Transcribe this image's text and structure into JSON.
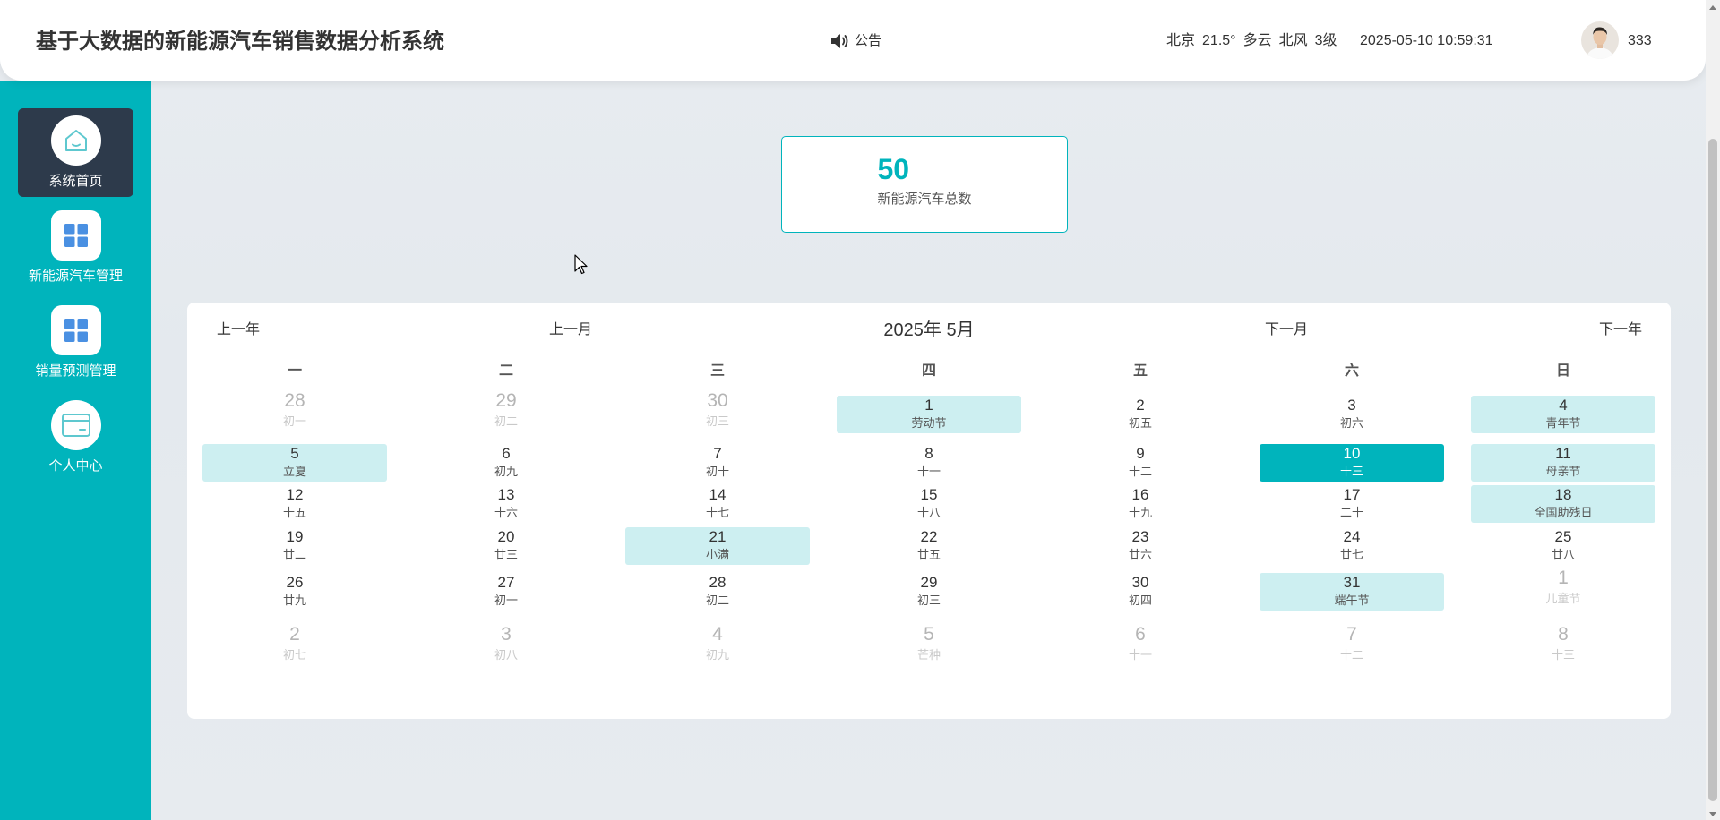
{
  "header": {
    "title": "基于大数据的新能源汽车销售数据分析系统",
    "notice_label": "公告",
    "weather": {
      "city": "北京",
      "temperature": "21.5°",
      "condition": "多云",
      "wind_direction": "北风",
      "wind_level": "3级"
    },
    "datetime": "2025-05-10 10:59:31",
    "username": "333"
  },
  "sidebar": {
    "items": [
      {
        "label": "系统首页",
        "icon": "home-icon",
        "active": true
      },
      {
        "label": "新能源汽车管理",
        "icon": "grid-icon",
        "active": false
      },
      {
        "label": "销量预测管理",
        "icon": "grid-icon",
        "active": false
      },
      {
        "label": "个人中心",
        "icon": "card-icon",
        "active": false
      }
    ]
  },
  "stats": {
    "total_value": "50",
    "total_label": "新能源汽车总数"
  },
  "calendar": {
    "prev_year": "上一年",
    "prev_month": "上一月",
    "title": "2025年 5月",
    "next_month": "下一月",
    "next_year": "下一年",
    "weekdays": [
      "一",
      "二",
      "三",
      "四",
      "五",
      "六",
      "日"
    ],
    "weeks": [
      [
        {
          "day": "28",
          "lunar": "初一",
          "other_month": true
        },
        {
          "day": "29",
          "lunar": "初二",
          "other_month": true
        },
        {
          "day": "30",
          "lunar": "初三",
          "other_month": true
        },
        {
          "day": "1",
          "lunar": "劳动节",
          "highlight": true
        },
        {
          "day": "2",
          "lunar": "初五"
        },
        {
          "day": "3",
          "lunar": "初六"
        },
        {
          "day": "4",
          "lunar": "青年节",
          "highlight": true
        }
      ],
      [
        {
          "day": "5",
          "lunar": "立夏",
          "highlight": true
        },
        {
          "day": "6",
          "lunar": "初九"
        },
        {
          "day": "7",
          "lunar": "初十"
        },
        {
          "day": "8",
          "lunar": "十一"
        },
        {
          "day": "9",
          "lunar": "十二"
        },
        {
          "day": "10",
          "lunar": "十三",
          "selected": true
        },
        {
          "day": "11",
          "lunar": "母亲节",
          "highlight": true
        }
      ],
      [
        {
          "day": "12",
          "lunar": "十五"
        },
        {
          "day": "13",
          "lunar": "十六"
        },
        {
          "day": "14",
          "lunar": "十七"
        },
        {
          "day": "15",
          "lunar": "十八"
        },
        {
          "day": "16",
          "lunar": "十九"
        },
        {
          "day": "17",
          "lunar": "二十"
        },
        {
          "day": "18",
          "lunar": "全国助残日",
          "highlight": true
        }
      ],
      [
        {
          "day": "19",
          "lunar": "廿二"
        },
        {
          "day": "20",
          "lunar": "廿三"
        },
        {
          "day": "21",
          "lunar": "小满",
          "highlight": true
        },
        {
          "day": "22",
          "lunar": "廿五"
        },
        {
          "day": "23",
          "lunar": "廿六"
        },
        {
          "day": "24",
          "lunar": "廿七"
        },
        {
          "day": "25",
          "lunar": "廿八"
        }
      ],
      [
        {
          "day": "26",
          "lunar": "廿九"
        },
        {
          "day": "27",
          "lunar": "初一"
        },
        {
          "day": "28",
          "lunar": "初二"
        },
        {
          "day": "29",
          "lunar": "初三"
        },
        {
          "day": "30",
          "lunar": "初四"
        },
        {
          "day": "31",
          "lunar": "端午节",
          "highlight": true
        },
        {
          "day": "1",
          "lunar": "儿童节",
          "other_month": true
        }
      ],
      [
        {
          "day": "2",
          "lunar": "初七",
          "other_month": true
        },
        {
          "day": "3",
          "lunar": "初八",
          "other_month": true
        },
        {
          "day": "4",
          "lunar": "初九",
          "other_month": true
        },
        {
          "day": "5",
          "lunar": "芒种",
          "other_month": true
        },
        {
          "day": "6",
          "lunar": "十一",
          "other_month": true
        },
        {
          "day": "7",
          "lunar": "十二",
          "other_month": true
        },
        {
          "day": "8",
          "lunar": "十三",
          "other_month": true
        }
      ]
    ]
  },
  "colors": {
    "accent": "#00b4bc",
    "sidebar_active": "#2d3a4b",
    "festival_highlight": "#cdeff1",
    "icon_blue": "#4a90e2",
    "icon_teal": "#5ec8cf"
  }
}
